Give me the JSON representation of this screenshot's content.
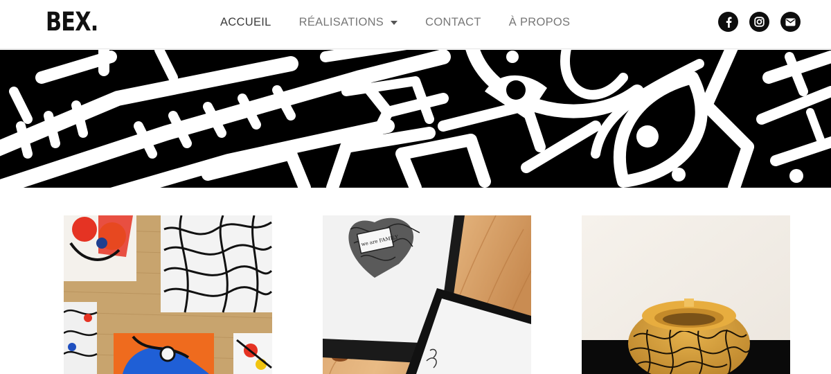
{
  "header": {
    "logo": "BEX.",
    "nav": [
      {
        "label": "ACCUEIL",
        "active": true
      },
      {
        "label": "RÉALISATIONS",
        "dropdown": true
      },
      {
        "label": "CONTACT"
      },
      {
        "label": "À PROPOS"
      }
    ],
    "social_icons": [
      "facebook-icon",
      "instagram-icon",
      "email-icon"
    ]
  },
  "gallery": {
    "tiles": [
      {
        "description_icon": "colorful-tiles-artwork"
      },
      {
        "text": "we are FAMILY"
      },
      {
        "description_icon": "painted-ashtray"
      }
    ]
  },
  "colors": {
    "nav_text": "#777777",
    "nav_active": "#3b3b3b",
    "icon_bg": "#0d0d0d",
    "banner_bg": "#000000"
  }
}
